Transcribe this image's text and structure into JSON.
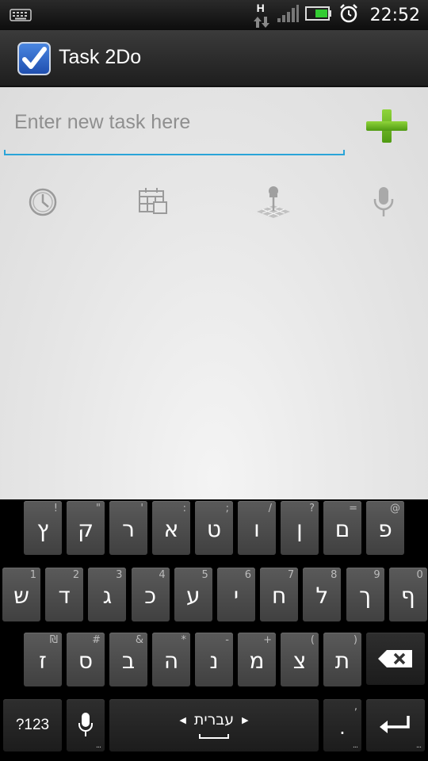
{
  "status_bar": {
    "time": "22:52",
    "network_type": "H",
    "icons": [
      "keyboard-icon",
      "data-arrows-icon",
      "signal-icon",
      "battery-icon",
      "alarm-icon"
    ]
  },
  "app": {
    "title": "Task 2Do",
    "icon": "checkbox-icon"
  },
  "task_entry": {
    "placeholder": "Enter new task here",
    "value": "",
    "add_icon": "plus-icon",
    "accent_color": "#2aa4d8"
  },
  "toolbar": [
    {
      "icon": "clock-icon"
    },
    {
      "icon": "calendar-icon"
    },
    {
      "icon": "location-pin-icon"
    },
    {
      "icon": "microphone-icon"
    }
  ],
  "keyboard": {
    "language": "עברית",
    "symbols_label": "?123",
    "row1": [
      {
        "main": "ץ",
        "alt": "!"
      },
      {
        "main": "ק",
        "alt": "\""
      },
      {
        "main": "ר",
        "alt": "'"
      },
      {
        "main": "א",
        "alt": ":"
      },
      {
        "main": "ט",
        "alt": ";"
      },
      {
        "main": "ו",
        "alt": "/"
      },
      {
        "main": "ן",
        "alt": "?"
      },
      {
        "main": "ם",
        "alt": "="
      },
      {
        "main": "פ",
        "alt": "@"
      }
    ],
    "row2": [
      {
        "main": "ש",
        "alt": "1"
      },
      {
        "main": "ד",
        "alt": "2"
      },
      {
        "main": "ג",
        "alt": "3"
      },
      {
        "main": "כ",
        "alt": "4"
      },
      {
        "main": "ע",
        "alt": "5"
      },
      {
        "main": "י",
        "alt": "6"
      },
      {
        "main": "ח",
        "alt": "7"
      },
      {
        "main": "ל",
        "alt": "8"
      },
      {
        "main": "ך",
        "alt": "9"
      },
      {
        "main": "ף",
        "alt": "0"
      }
    ],
    "row3": [
      {
        "main": "ז",
        "alt": "₪"
      },
      {
        "main": "ס",
        "alt": "#"
      },
      {
        "main": "ב",
        "alt": "&"
      },
      {
        "main": "ה",
        "alt": "*"
      },
      {
        "main": "נ",
        "alt": "-"
      },
      {
        "main": "מ",
        "alt": "+"
      },
      {
        "main": "צ",
        "alt": "("
      },
      {
        "main": "ת",
        "alt": ")"
      }
    ],
    "period_key": {
      "main": ".",
      "alt": ","
    },
    "more_dots": "..."
  }
}
